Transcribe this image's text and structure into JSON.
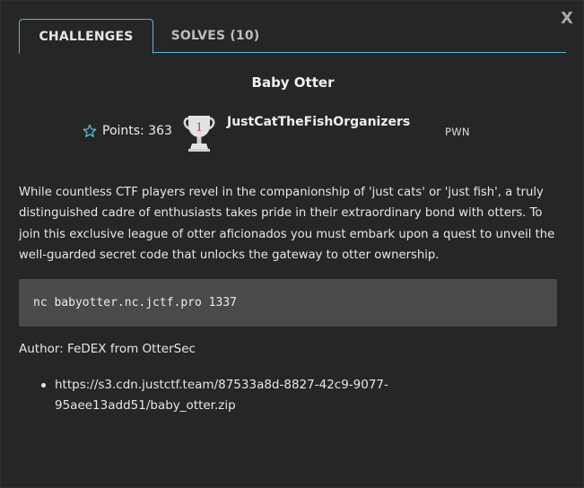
{
  "close_label": "X",
  "tabs": [
    {
      "label": "CHALLENGES"
    },
    {
      "label": "SOLVES (10)"
    }
  ],
  "challenge": {
    "title": "Baby Otter",
    "points_label": "Points: 363",
    "first_blood_rank": "1",
    "first_blood_team": "JustCatTheFishOrganizers",
    "category": "PWN",
    "description": "While countless CTF players revel in the companionship of 'just cats' or 'just fish', a truly distinguished cadre of enthusiasts takes pride in their extraordinary bond with otters. To join this exclusive league of otter aficionados you must embark upon a quest to unveil the well-guarded secret code that unlocks the gateway to otter ownership.",
    "connection": "nc babyotter.nc.jctf.pro 1337",
    "author": "Author: FeDEX from OtterSec",
    "files": [
      "https://s3.cdn.justctf.team/87533a8d-8827-42c9-9077-95aee13add51/baby_otter.zip"
    ]
  },
  "colors": {
    "background": "#262626",
    "accent": "#56b8d6",
    "code_background": "#4a4a4a",
    "trophy": "#d9d9d9",
    "rank_text": "#c0392b"
  },
  "icons": {
    "points": "star-icon",
    "first_blood": "trophy-icon"
  }
}
